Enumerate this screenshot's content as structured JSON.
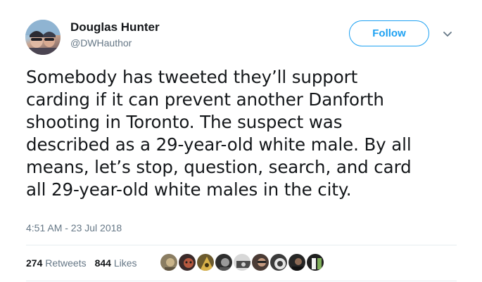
{
  "tweet": {
    "user": {
      "name": "Douglas Hunter",
      "handle": "@DWHauthor"
    },
    "follow_label": "Follow",
    "caret_icon": "chevron-down-icon",
    "text_lines": [
      "Somebody has tweeted they’ll support",
      "carding if it can prevent another Danforth",
      "shooting in Toronto. The suspect was",
      "described as a 29-year-old white male. By all",
      "means, let’s stop, question, search, and card",
      "all 29-year-old white males in the city."
    ],
    "timestamp": "4:51 AM - 23 Jul 2018",
    "stats": {
      "retweets_count": "274",
      "retweets_label": "Retweets",
      "likes_count": "844",
      "likes_label": "Likes"
    }
  },
  "colors": {
    "accent": "#1da1f2",
    "secondary_text": "#657786",
    "divider": "#e6ecf0"
  }
}
